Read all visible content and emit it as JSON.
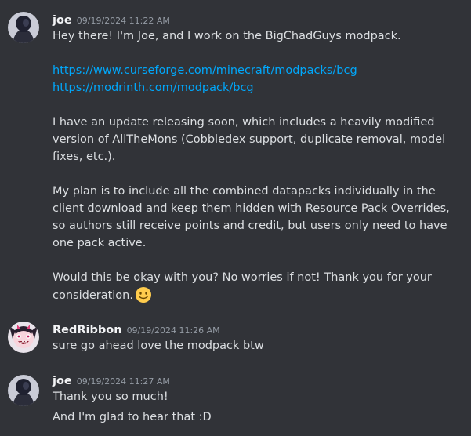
{
  "messages": [
    {
      "username": "joe",
      "timestamp": "09/19/2024 11:22 AM",
      "lines": {
        "l1": "Hey there! I'm Joe, and I work on the BigChadGuys modpack.",
        "link1": "https://www.curseforge.com/minecraft/modpacks/bcg",
        "link2": "https://modrinth.com/modpack/bcg",
        "p2a": "I have an update releasing soon, which includes a heavily modified",
        "p2b": "version of AllTheMons (Cobbledex support, duplicate removal, model",
        "p2c": "fixes, etc.).",
        "p3a": "My plan is to include all the combined datapacks individually in the",
        "p3b": "client download and keep them hidden with Resource Pack Overrides,",
        "p3c": "so authors still receive points and credit, but users only need to have",
        "p3d": "one pack active.",
        "p4a": "Would this be okay with you? No worries if not! Thank you for your",
        "p4b": "consideration."
      },
      "emoji": "slightly-smiling-face"
    },
    {
      "username": "RedRibbon",
      "timestamp": "09/19/2024 11:26 AM",
      "text": "sure go ahead love the modpack btw"
    },
    {
      "username": "joe",
      "timestamp": "09/19/2024 11:27 AM",
      "line1": "Thank you so much!",
      "line2": "And I'm glad to hear that :D"
    }
  ],
  "colors": {
    "background": "#313338",
    "link": "#00a8fc",
    "username": "#f2f3f5",
    "timestamp": "#949ba4",
    "text": "#dbdee1"
  }
}
